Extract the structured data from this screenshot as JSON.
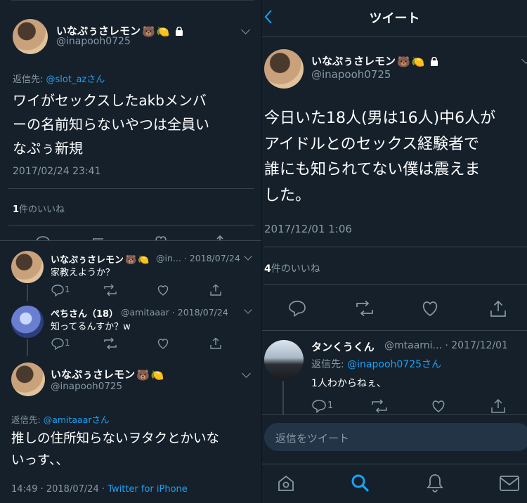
{
  "left": {
    "main_tweet": {
      "display_name": "いなぷぅさレモン",
      "handle": "@inapooh0725",
      "reply_to_label": "返信先: ",
      "reply_to_user": "@slot_az",
      "reply_to_suffix": "さん",
      "text_line1": "ワイがセックスしたakbメンバ",
      "text_line2": "ーの名前知らないやつは全員い",
      "text_line3": "なぷぅ新規",
      "timestamp": "2017/02/24 23:41",
      "likes_number": "1",
      "likes_label": "件のいいね"
    },
    "replies": [
      {
        "display_name": "いなぷぅさレモン",
        "meta": "@in... · 2018/07/24",
        "text": "家教えようか？",
        "reply_count": "1"
      },
      {
        "display_name": "ぺちさん（18）",
        "meta": "@amitaaar · 2018/07/24",
        "text": "知ってるんすか？w",
        "reply_count": "1"
      }
    ],
    "bottom_tweet": {
      "display_name": "いなぷぅさレモン",
      "handle": "@inapooh0725",
      "reply_to_label": "返信先: ",
      "reply_to_user": "@amitaaar",
      "reply_to_suffix": "さん",
      "text_line1": "推しの住所知らないヲタクとかいな",
      "text_line2": "いっす、、",
      "timestamp": "14:49 · 2018/07/24 · ",
      "source": "Twitter for iPhone"
    }
  },
  "right": {
    "header_title": "ツイート",
    "main_tweet": {
      "display_name": "いなぷぅさレモン",
      "handle": "@inapooh0725",
      "text_line1": "今日いた18人(男は16人)中6人が",
      "text_line2": "アイドルとのセックス経験者で",
      "text_line3": "誰にも知られてない僕は震えま",
      "text_line4": "した。",
      "timestamp": "2017/12/01 1:06",
      "likes_number": "4",
      "likes_label": "件のいいね"
    },
    "reply": {
      "display_name": "タンくうくん",
      "meta": "@mtaarni... · 2017/12/01",
      "reply_to_label": "返信先: ",
      "reply_to_user": "@inapooh0725",
      "reply_to_suffix": "さん",
      "text": "1人わからねぇ、",
      "reply_count": "1"
    },
    "reply_input_placeholder": "返信をツイート"
  },
  "colors": {
    "background": "#15202b",
    "text": "#ffffff",
    "muted": "#8899a6",
    "accent": "#1da1f2",
    "divider": "#38444d"
  },
  "icons": [
    "back-icon",
    "lock-icon",
    "bear-emoji",
    "lemon-emoji",
    "chevron-down-icon",
    "reply-icon",
    "retweet-icon",
    "like-icon",
    "share-icon",
    "home-icon",
    "search-icon",
    "notifications-icon",
    "messages-icon"
  ]
}
